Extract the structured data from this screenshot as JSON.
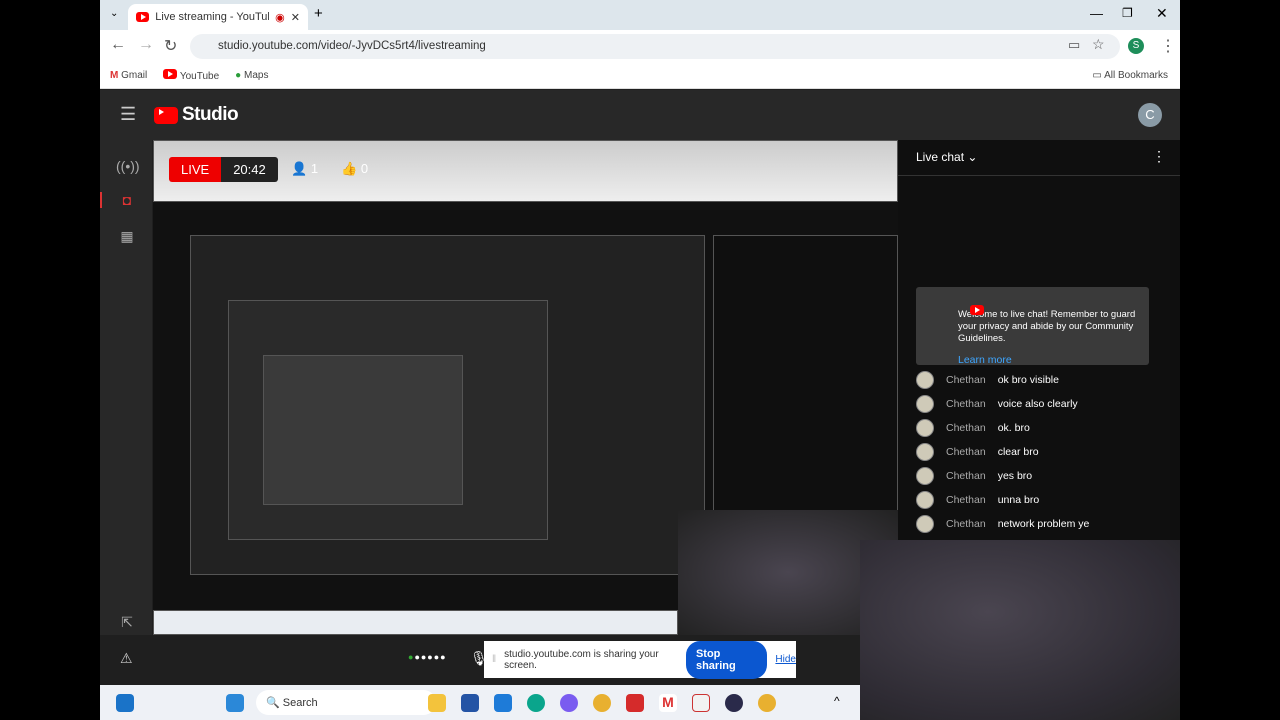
{
  "browser": {
    "tab_title": "Live streaming - YouTube Studio",
    "url": "studio.youtube.com/video/-JyvDCs5rt4/livestreaming",
    "bookmarks": [
      "Gmail",
      "YouTube",
      "Maps"
    ],
    "all_bookmarks": "All Bookmarks",
    "profile_initial": "S"
  },
  "studio": {
    "logo": "Studio",
    "avatar_initial": "C"
  },
  "stream": {
    "live_label": "LIVE",
    "elapsed": "20:42",
    "viewers": "1",
    "likes": "0"
  },
  "chat": {
    "title": "Live chat",
    "welcome": "Welcome to live chat! Remember to guard your privacy and abide by our Community Guidelines.",
    "learn_more": "Learn more",
    "messages": [
      {
        "author": "Chethan",
        "text": "ok bro visible"
      },
      {
        "author": "Chethan",
        "text": "voice also clearly"
      },
      {
        "author": "Chethan",
        "text": "ok. bro"
      },
      {
        "author": "Chethan",
        "text": "clear bro"
      },
      {
        "author": "Chethan",
        "text": "yes bro"
      },
      {
        "author": "Chethan",
        "text": "unna bro"
      },
      {
        "author": "Chethan",
        "text": "network problem ye"
      }
    ]
  },
  "share_bar": {
    "message": "studio.youtube.com is sharing your screen.",
    "stop": "Stop sharing",
    "hide": "Hide"
  },
  "taskbar": {
    "search": "Search"
  }
}
